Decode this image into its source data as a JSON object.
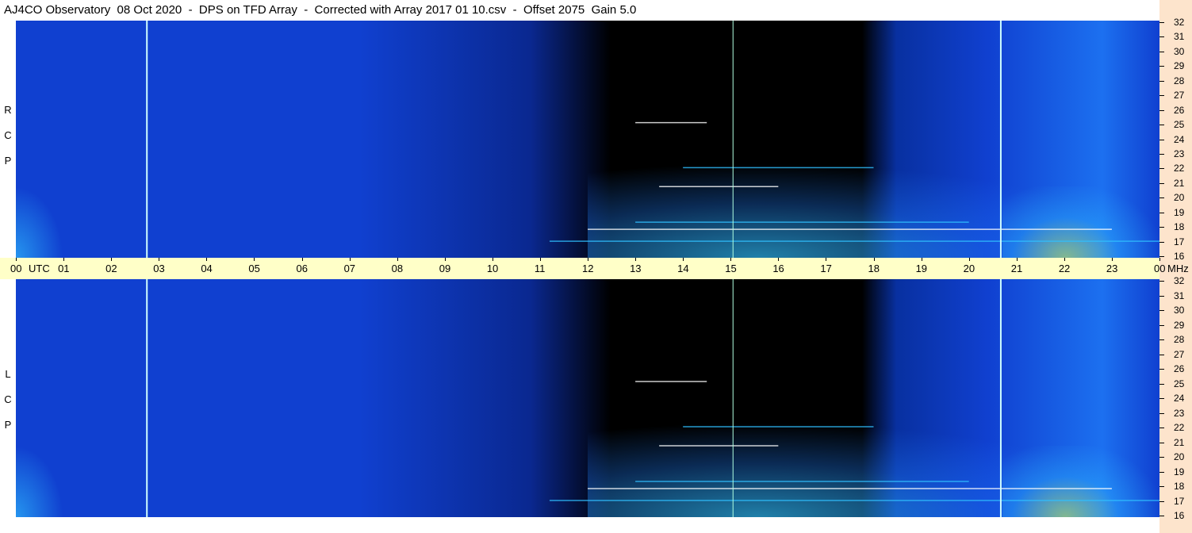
{
  "title": "AJ4CO Observatory  08 Oct 2020  -  DPS on TFD Array  -  Corrected with Array 2017 01 10.csv  -  Offset 2075  Gain 5.0",
  "panels": [
    {
      "name": "rcp",
      "letters": [
        "R",
        "C",
        "P"
      ]
    },
    {
      "name": "lcp",
      "letters": [
        "L",
        "C",
        "P"
      ]
    }
  ],
  "colors": {
    "low": "#000000",
    "mid": "#1040d0",
    "high": "#30c0ff",
    "peak": "#e0ff40",
    "background_strip": "#fde4cc",
    "time_bar": "#ffffc8"
  },
  "chart_data": {
    "type": "heatmap",
    "x_tick_labels": [
      "00",
      "UTC",
      "01",
      "02",
      "03",
      "04",
      "05",
      "06",
      "07",
      "08",
      "09",
      "10",
      "11",
      "12",
      "13",
      "14",
      "15",
      "16",
      "17",
      "18",
      "19",
      "20",
      "21",
      "22",
      "23",
      "00",
      "MHz"
    ],
    "x_hours": [
      0,
      1,
      2,
      3,
      4,
      5,
      6,
      7,
      8,
      9,
      10,
      11,
      12,
      13,
      14,
      15,
      16,
      17,
      18,
      19,
      20,
      21,
      22,
      23,
      24
    ],
    "xlim": [
      0,
      24
    ],
    "y_tick_labels": [
      "32",
      "31",
      "30",
      "29",
      "28",
      "27",
      "26",
      "25",
      "24",
      "23",
      "22",
      "21",
      "20",
      "19",
      "18",
      "17",
      "16"
    ],
    "ylim": [
      16,
      32
    ],
    "spectrogram_panels": [
      "RCP",
      "LCP"
    ],
    "vertical_events_utc": [
      2.75,
      15.05,
      20.67
    ]
  }
}
